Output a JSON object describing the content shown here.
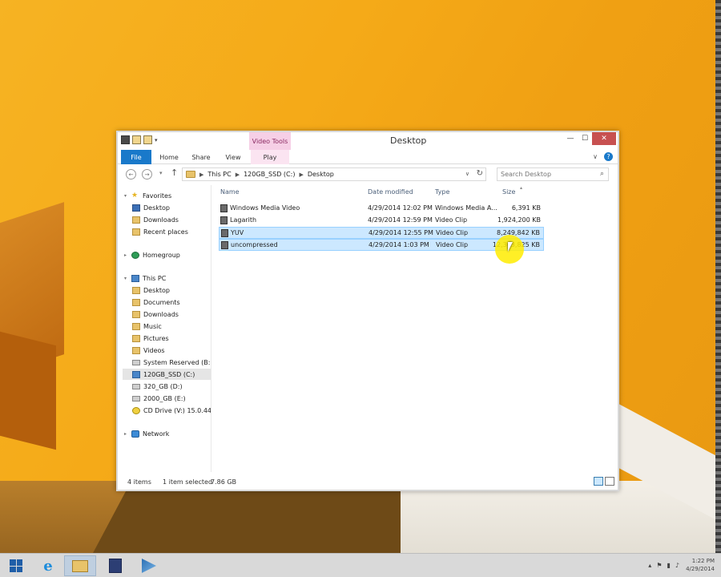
{
  "window": {
    "title": "Desktop",
    "context_tab": "Video Tools",
    "controls": {
      "minimize": "—",
      "maximize": "☐",
      "close": "✕"
    }
  },
  "ribbon": {
    "tabs": [
      {
        "label": "File"
      },
      {
        "label": "Home"
      },
      {
        "label": "Share"
      },
      {
        "label": "View"
      },
      {
        "label": "Play"
      }
    ],
    "help": "?"
  },
  "address": {
    "crumbs": [
      "This PC",
      "120GB_SSD (C:)",
      "Desktop"
    ],
    "search_placeholder": "Search Desktop"
  },
  "nav": {
    "favorites": "Favorites",
    "favorites_items": [
      "Desktop",
      "Downloads",
      "Recent places"
    ],
    "homegroup": "Homegroup",
    "thispc": "This PC",
    "thispc_items": [
      "Desktop",
      "Documents",
      "Downloads",
      "Music",
      "Pictures",
      "Videos",
      "System Reserved (B:",
      "120GB_SSD (C:)",
      "320_GB (D:)",
      "2000_GB (E:)",
      "CD Drive (V:) 15.0.44"
    ],
    "network": "Network"
  },
  "columns": {
    "name": "Name",
    "date": "Date modified",
    "type": "Type",
    "size": "Size"
  },
  "files": [
    {
      "name": "Windows Media Video",
      "date": "4/29/2014 12:02 PM",
      "type": "Windows Media A...",
      "size": "6,391 KB"
    },
    {
      "name": "Lagarith",
      "date": "4/29/2014 12:59 PM",
      "type": "Video Clip",
      "size": "1,924,200 KB"
    },
    {
      "name": "YUV",
      "date": "4/29/2014 12:55 PM",
      "type": "Video Clip",
      "size": "8,249,842 KB"
    },
    {
      "name": "uncompressed",
      "date": "4/29/2014 1:03 PM",
      "type": "Video Clip",
      "size": "12,363,825 KB"
    }
  ],
  "status": {
    "count": "4 items",
    "selection": "1 item selected",
    "selection_size": "7.86 GB"
  },
  "taskbar": {
    "clock_time": "1:22 PM",
    "clock_date": "4/29/2014"
  }
}
